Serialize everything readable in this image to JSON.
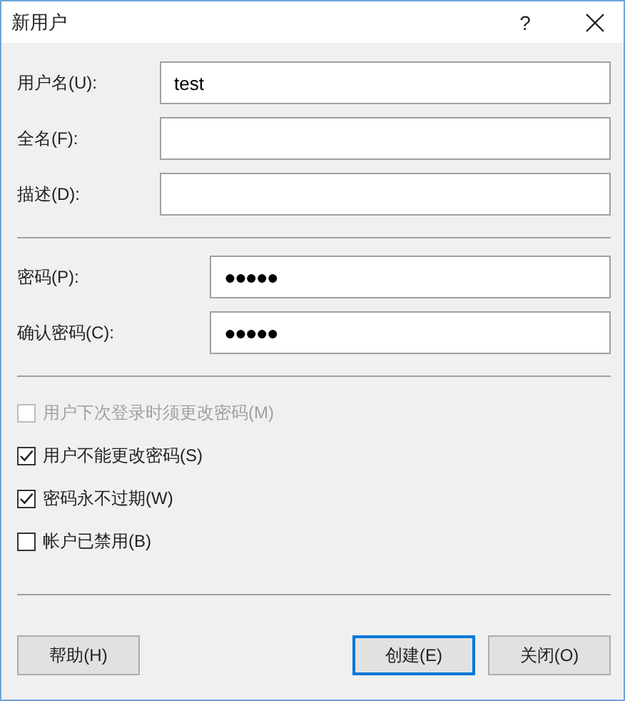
{
  "window": {
    "title": "新用户",
    "help": "?"
  },
  "field_groups": [
    {
      "fields": [
        {
          "label": "用户名(U):",
          "value": "test"
        },
        {
          "label": "全名(F):"
        },
        {
          "label": "描述(D):"
        }
      ]
    },
    {
      "fields": [
        {
          "label": "密码(P):",
          "value": "●●●●●"
        },
        {
          "label": "确认密码(C):",
          "value": "●●●●●"
        }
      ]
    }
  ],
  "options": [
    {
      "label": "用户下次登录时须更改密码(M)",
      "checked": false,
      "disabled": true
    },
    {
      "label": "用户不能更改密码(S)",
      "checked": true,
      "disabled": false
    },
    {
      "label": "密码永不过期(W)",
      "checked": true,
      "disabled": false
    },
    {
      "label": "帐户已禁用(B)",
      "checked": false,
      "disabled": false
    }
  ],
  "buttons": [
    {
      "label": "帮助(H)",
      "focused": false
    },
    {
      "label": "创建(E)",
      "focused": true
    },
    {
      "label": "关闭(O)",
      "focused": false
    }
  ]
}
